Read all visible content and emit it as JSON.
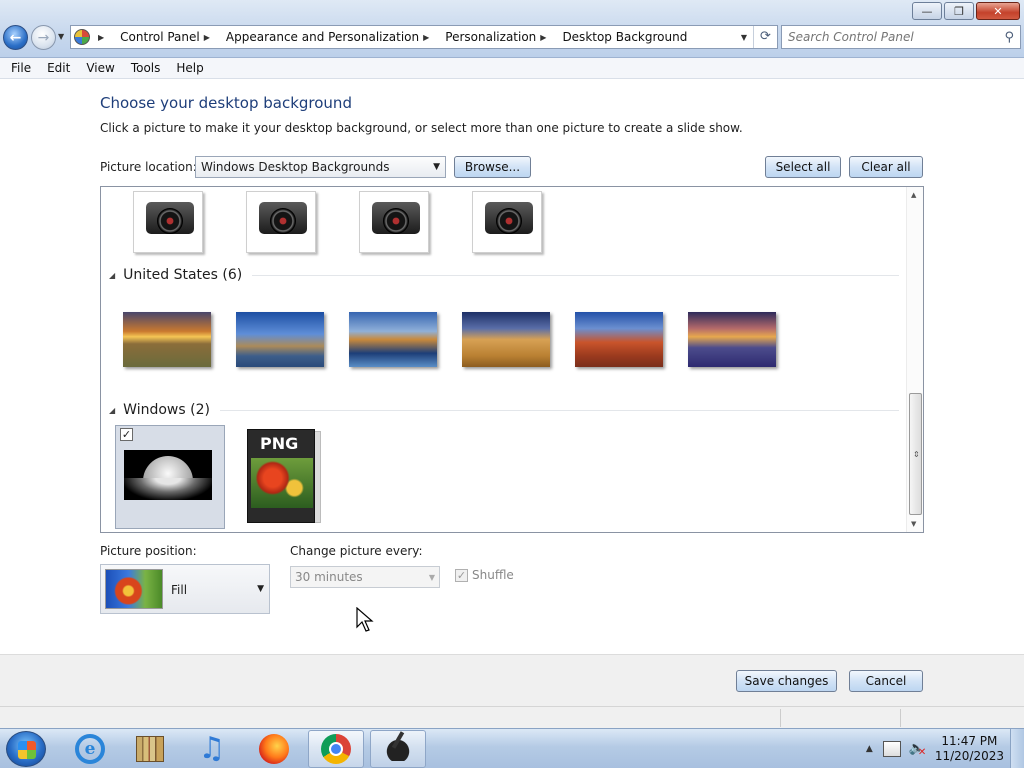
{
  "window": {
    "controls": {
      "minimize": "—",
      "maximize": "❐",
      "close": "✕"
    }
  },
  "nav": {
    "back": "←",
    "forward": "→",
    "breadcrumbs": [
      "Control Panel",
      "Appearance and Personalization",
      "Personalization",
      "Desktop Background"
    ],
    "search_placeholder": "Search Control Panel"
  },
  "menu": [
    "File",
    "Edit",
    "View",
    "Tools",
    "Help"
  ],
  "main": {
    "heading": "Choose your desktop background",
    "subtext": "Click a picture to make it your desktop background, or select more than one picture to create a slide show.",
    "location_label": "Picture location:",
    "location_value": "Windows Desktop Backgrounds",
    "browse": "Browse...",
    "select_all": "Select all",
    "clear_all": "Clear all"
  },
  "gallery": {
    "groups": [
      {
        "title": "United States (6)",
        "items": 6
      },
      {
        "title": "Windows (2)",
        "items": 2
      }
    ],
    "png_label": "PNG",
    "checked_mark": "✓"
  },
  "options": {
    "position_label": "Picture position:",
    "position_value": "Fill",
    "change_label": "Change picture every:",
    "change_value": "30 minutes",
    "shuffle_label": "Shuffle",
    "shuffle_mark": "✓"
  },
  "footer": {
    "save": "Save changes",
    "cancel": "Cancel"
  },
  "taskbar": {
    "ie_glyph": "e",
    "music_glyph": "♫",
    "time": "11:47 PM",
    "date": "11/20/2023"
  }
}
